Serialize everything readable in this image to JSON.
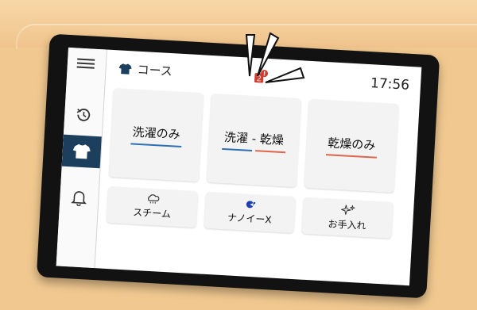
{
  "header": {
    "title": "コース",
    "clock": "17:56",
    "warning_count": "2"
  },
  "sidebar": {
    "items": [
      {
        "name": "menu",
        "icon": "hamburger-menu-icon"
      },
      {
        "name": "history",
        "icon": "history-icon"
      },
      {
        "name": "course",
        "icon": "shirt-icon",
        "active": true
      },
      {
        "name": "notifications",
        "icon": "bell-icon"
      }
    ]
  },
  "courses": [
    {
      "label": "洗濯のみ",
      "underline": [
        "#2f6fb5"
      ]
    },
    {
      "label": "洗濯 - 乾燥",
      "underline": [
        "#2f6fb5",
        "#e0654a"
      ]
    },
    {
      "label": "乾燥のみ",
      "underline": [
        "#e0654a"
      ]
    }
  ],
  "options": [
    {
      "label": "スチーム",
      "icon": "steam-cloud-icon"
    },
    {
      "label": "ナノイーX",
      "icon": "nanoe-x-icon"
    },
    {
      "label": "お手入れ",
      "icon": "sparkle-icon"
    }
  ],
  "colors": {
    "accent": "#1d3f5e",
    "wash": "#2f6fb5",
    "dry": "#e0654a",
    "body": "#f1c990"
  }
}
